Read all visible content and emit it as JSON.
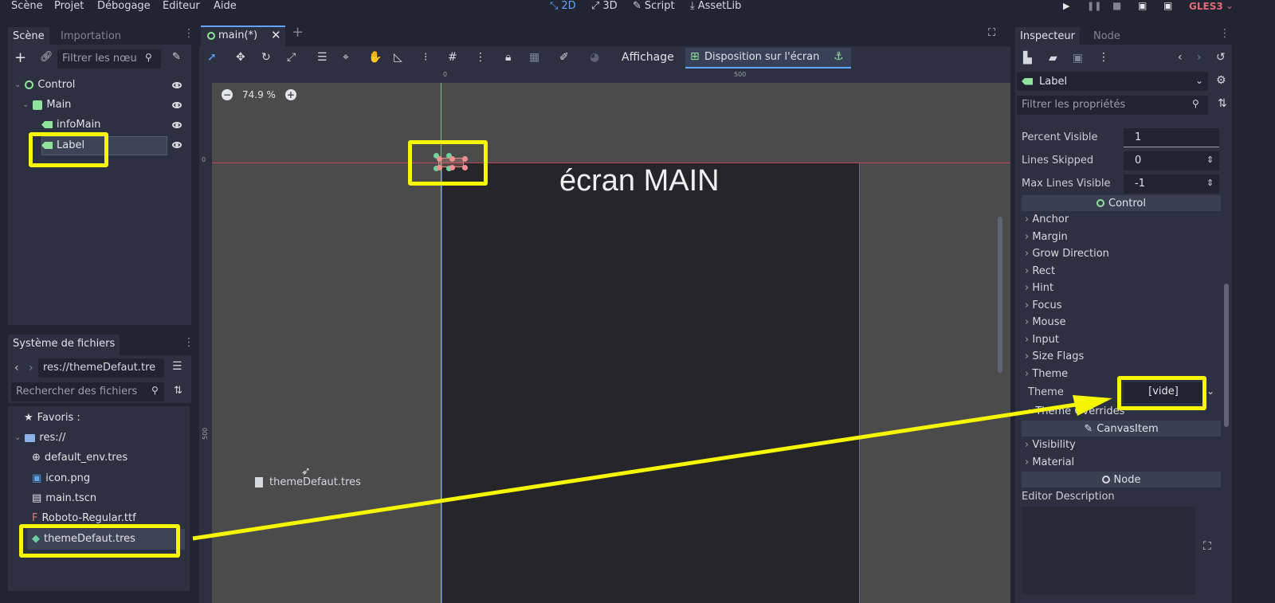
{
  "menu": [
    "Scène",
    "Projet",
    "Débogage",
    "Éditeur",
    "Aide"
  ],
  "modes": {
    "m2d": "2D",
    "m3d": "3D",
    "script": "Script",
    "assetlib": "AssetLib"
  },
  "renderer": "GLES3",
  "scene_dock": {
    "tabs": [
      "Scène",
      "Importation"
    ],
    "filter_placeholder": "Filtrer les nœu",
    "tree": [
      {
        "label": "Control"
      },
      {
        "label": "Main"
      },
      {
        "label": "infoMain"
      },
      {
        "label": "Label"
      }
    ]
  },
  "filesystem_dock": {
    "title": "Système de fichiers",
    "path": "res://themeDefaut.tre",
    "search_placeholder": "Rechercher des fichiers",
    "items": [
      "Favoris :",
      "res://",
      "default_env.tres",
      "icon.png",
      "main.tscn",
      "Roboto-Regular.ttf",
      "themeDefaut.tres"
    ]
  },
  "editor": {
    "tab": "main(*)",
    "toolbar": {
      "view_label": "Affichage",
      "layout_label": "Disposition sur l'écran"
    },
    "zoom": "74.9 %",
    "ruler_labels": {
      "x0": "0",
      "x500": "500",
      "y0": "0",
      "y500": "500"
    },
    "canvas_text": "écran MAIN",
    "drag_label": "themeDefaut.tres"
  },
  "inspector": {
    "tabs": [
      "Inspecteur",
      "Node"
    ],
    "node_name": "Label",
    "filter_placeholder": "Filtrer les propriétés",
    "props": [
      {
        "label": "Percent Visible",
        "value": "1"
      },
      {
        "label": "Lines Skipped",
        "value": "0"
      },
      {
        "label": "Max Lines Visible",
        "value": "-1"
      }
    ],
    "control_section": "Control",
    "groups": [
      "Anchor",
      "Margin",
      "Grow Direction",
      "Rect",
      "Hint",
      "Focus",
      "Mouse",
      "Input",
      "Size Flags",
      "Theme"
    ],
    "theme_label": "Theme",
    "theme_value": "[vide]",
    "theme_overrides": "Theme Overrides",
    "canvasitem_section": "CanvasItem",
    "canvas_groups": [
      "Visibility",
      "Material"
    ],
    "node_section": "Node",
    "editor_description": "Editor Description"
  },
  "colors": {
    "highlight": "#f6f600",
    "accent": "#62a3ff",
    "node_green": "#8fe39a"
  }
}
